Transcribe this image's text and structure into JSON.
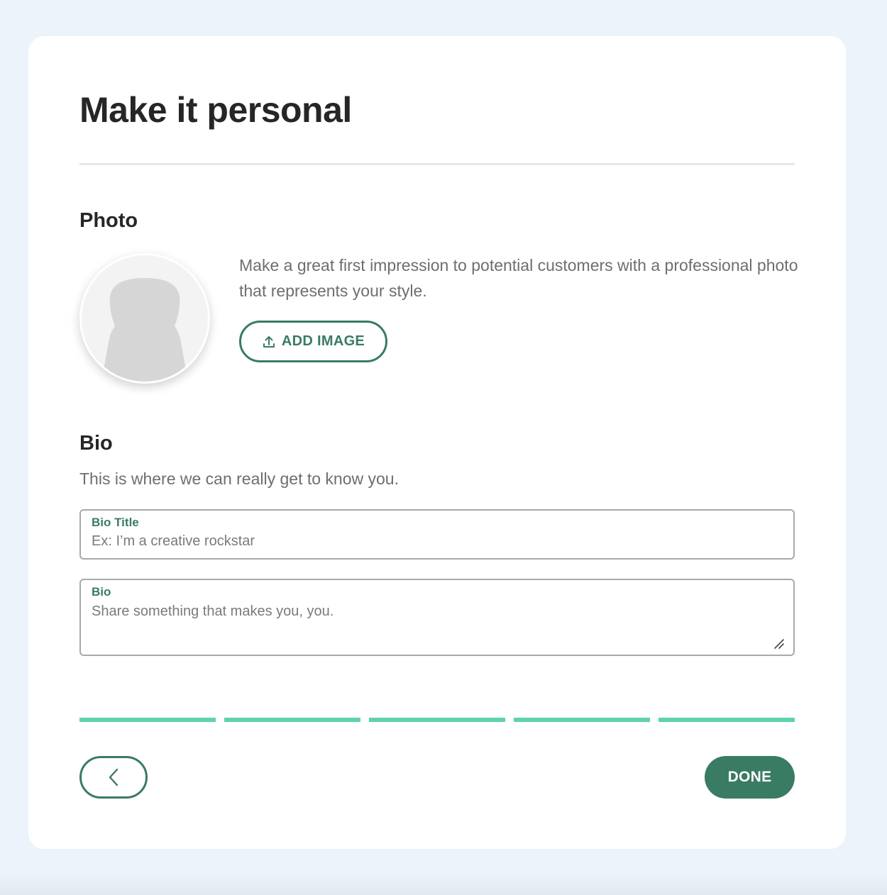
{
  "page": {
    "title": "Make it personal"
  },
  "photo": {
    "heading": "Photo",
    "description": "Make a great first impression to potential customers with a professional photo that represents your style.",
    "add_image_label": "ADD IMAGE",
    "upload_icon": "upload-icon",
    "avatar_icon": "person-silhouette-icon"
  },
  "bio": {
    "heading": "Bio",
    "description": "This is where we can really get to know you.",
    "title_field": {
      "label": "Bio Title",
      "placeholder": "Ex: I’m a creative rockstar",
      "value": ""
    },
    "bio_field": {
      "label": "Bio",
      "placeholder": "Share something that makes you, you.",
      "value": ""
    }
  },
  "progress": {
    "total_steps": 5,
    "completed_steps": 5
  },
  "footer": {
    "back_icon": "chevron-left-icon",
    "done_label": "DONE"
  },
  "colors": {
    "brand": "#3a7b63",
    "progress": "#5ed3a6",
    "background": "#ecf3fb"
  }
}
